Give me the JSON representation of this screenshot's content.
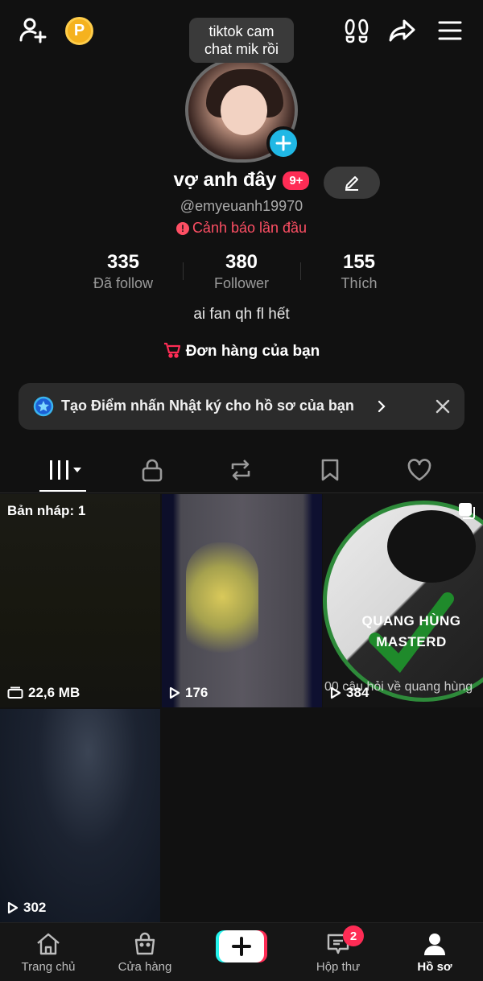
{
  "tooltip": {
    "line1": "tiktok cam",
    "line2": "chat mik rồi"
  },
  "top_bar": {
    "coin_letter": "P"
  },
  "profile": {
    "name": "vợ anh đây",
    "notif_badge": "9+",
    "handle": "@emyeuanh19970",
    "warning": "Cảnh báo lần đầu",
    "bio": "ai fan qh fl hết"
  },
  "stats": [
    {
      "value": "335",
      "label": "Đã follow"
    },
    {
      "value": "380",
      "label": "Follower"
    },
    {
      "value": "155",
      "label": "Thích"
    }
  ],
  "orders_label": "Đơn hàng của bạn",
  "banner": {
    "text": "Tạo Điểm nhấn Nhật ký cho hồ sơ của bạn"
  },
  "grid": {
    "draft_label": "Bản nháp: 1",
    "draft_size": "22,6 MB",
    "videos": [
      {
        "views": "176"
      },
      {
        "views": "384",
        "overlay_title": "QUANG HÙNG MASTERD",
        "caption": "00 câu hỏi về quang hùng"
      },
      {
        "views": "302"
      }
    ]
  },
  "bottom_nav": {
    "home": "Trang chủ",
    "shop": "Cửa hàng",
    "inbox": "Hộp thư",
    "inbox_badge": "2",
    "profile": "Hồ sơ"
  },
  "colors": {
    "accent": "#fe2c55",
    "cyan": "#20b8e5",
    "warning": "#fe4f64",
    "coin": "#f5b21e"
  }
}
